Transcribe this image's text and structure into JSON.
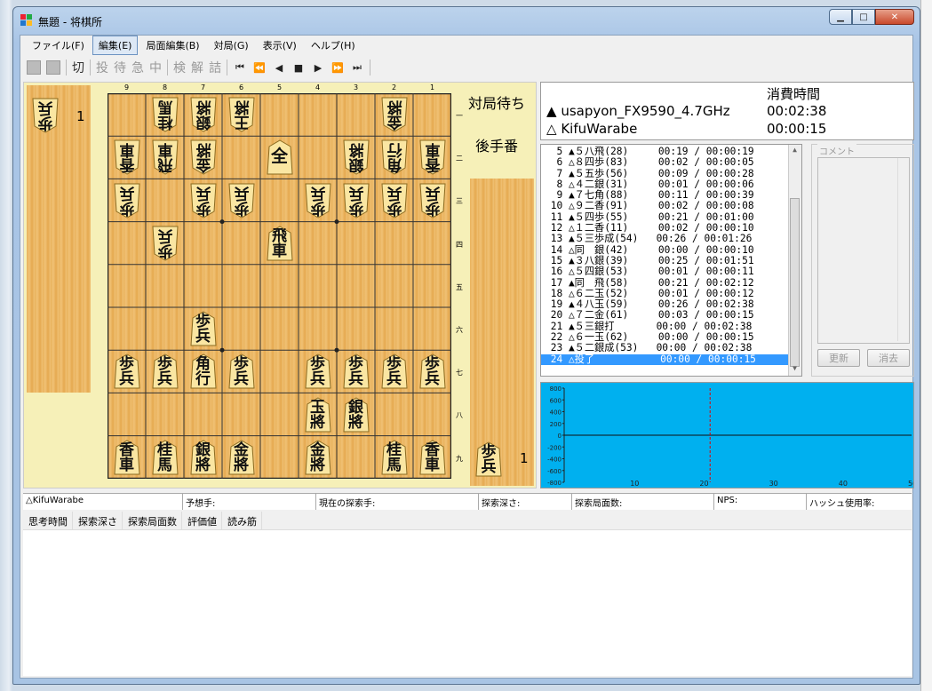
{
  "window": {
    "title": "無題 - 将棋所"
  },
  "menu": [
    "ファイル(F)",
    "編集(E)",
    "局面編集(B)",
    "対局(G)",
    "表示(V)",
    "ヘルプ(H)"
  ],
  "toolbar": {
    "cut": "切",
    "toolchars": [
      "投",
      "待",
      "急",
      "中",
      "検",
      "解",
      "詰"
    ]
  },
  "board": {
    "files": [
      "9",
      "8",
      "7",
      "6",
      "5",
      "4",
      "3",
      "2",
      "1"
    ],
    "ranks": [
      "一",
      "二",
      "三",
      "四",
      "五",
      "六",
      "七",
      "八",
      "九"
    ],
    "pieces": [
      {
        "f": 8,
        "r": 1,
        "t": "桂馬",
        "s": "g"
      },
      {
        "f": 7,
        "r": 1,
        "t": "銀將",
        "s": "g"
      },
      {
        "f": 6,
        "r": 1,
        "t": "王將",
        "s": "g"
      },
      {
        "f": 2,
        "r": 1,
        "t": "金將",
        "s": "g"
      },
      {
        "f": 9,
        "r": 2,
        "t": "香車",
        "s": "g"
      },
      {
        "f": 8,
        "r": 2,
        "t": "飛車",
        "s": "g"
      },
      {
        "f": 7,
        "r": 2,
        "t": "金將",
        "s": "g"
      },
      {
        "f": 5,
        "r": 2,
        "t": "全",
        "s": "s"
      },
      {
        "f": 3,
        "r": 2,
        "t": "銀將",
        "s": "g"
      },
      {
        "f": 2,
        "r": 2,
        "t": "角行",
        "s": "g"
      },
      {
        "f": 1,
        "r": 2,
        "t": "香車",
        "s": "g"
      },
      {
        "f": 9,
        "r": 3,
        "t": "歩兵",
        "s": "g"
      },
      {
        "f": 7,
        "r": 3,
        "t": "歩兵",
        "s": "g"
      },
      {
        "f": 6,
        "r": 3,
        "t": "歩兵",
        "s": "g"
      },
      {
        "f": 4,
        "r": 3,
        "t": "歩兵",
        "s": "g"
      },
      {
        "f": 3,
        "r": 3,
        "t": "歩兵",
        "s": "g"
      },
      {
        "f": 2,
        "r": 3,
        "t": "歩兵",
        "s": "g"
      },
      {
        "f": 1,
        "r": 3,
        "t": "歩兵",
        "s": "g"
      },
      {
        "f": 8,
        "r": 4,
        "t": "歩兵",
        "s": "g"
      },
      {
        "f": 5,
        "r": 4,
        "t": "飛車",
        "s": "s"
      },
      {
        "f": 7,
        "r": 6,
        "t": "歩兵",
        "s": "s"
      },
      {
        "f": 9,
        "r": 7,
        "t": "歩兵",
        "s": "s"
      },
      {
        "f": 8,
        "r": 7,
        "t": "歩兵",
        "s": "s"
      },
      {
        "f": 7,
        "r": 7,
        "t": "角行",
        "s": "s"
      },
      {
        "f": 6,
        "r": 7,
        "t": "歩兵",
        "s": "s"
      },
      {
        "f": 4,
        "r": 7,
        "t": "歩兵",
        "s": "s"
      },
      {
        "f": 3,
        "r": 7,
        "t": "歩兵",
        "s": "s"
      },
      {
        "f": 2,
        "r": 7,
        "t": "歩兵",
        "s": "s"
      },
      {
        "f": 1,
        "r": 7,
        "t": "歩兵",
        "s": "s"
      },
      {
        "f": 4,
        "r": 8,
        "t": "玉將",
        "s": "s"
      },
      {
        "f": 3,
        "r": 8,
        "t": "銀將",
        "s": "s"
      },
      {
        "f": 9,
        "r": 9,
        "t": "香車",
        "s": "s"
      },
      {
        "f": 8,
        "r": 9,
        "t": "桂馬",
        "s": "s"
      },
      {
        "f": 7,
        "r": 9,
        "t": "銀將",
        "s": "s"
      },
      {
        "f": 6,
        "r": 9,
        "t": "金將",
        "s": "s"
      },
      {
        "f": 4,
        "r": 9,
        "t": "金將",
        "s": "s"
      },
      {
        "f": 2,
        "r": 9,
        "t": "桂馬",
        "s": "s"
      },
      {
        "f": 1,
        "r": 9,
        "t": "香車",
        "s": "s"
      }
    ]
  },
  "hands": {
    "gote": {
      "piece": "歩兵",
      "count": "1"
    },
    "sente": {
      "piece": "歩兵",
      "count": "1"
    }
  },
  "status": {
    "state": "対局待ち",
    "turn": "後手番"
  },
  "clock": {
    "header": "消費時間",
    "sente": {
      "mark": "▲",
      "name": "usapyon_FX9590_4.7GHz",
      "time": "00:02:38"
    },
    "gote": {
      "mark": "△",
      "name": "KifuWarabe",
      "time": "00:00:15"
    }
  },
  "kifu": [
    "  5 ▲５八飛(28)     00:19 / 00:00:19",
    "  6 △８四歩(83)     00:02 / 00:00:05",
    "  7 ▲５五歩(56)     00:09 / 00:00:28",
    "  8 △４二銀(31)     00:01 / 00:00:06",
    "  9 ▲７七角(88)     00:11 / 00:00:39",
    " 10 △９二香(91)     00:02 / 00:00:08",
    " 11 ▲５四歩(55)     00:21 / 00:01:00",
    " 12 △１二香(11)     00:02 / 00:00:10",
    " 13 ▲５三歩成(54)   00:26 / 00:01:26",
    " 14 △同　銀(42)     00:00 / 00:00:10",
    " 15 ▲３八銀(39)     00:25 / 00:01:51",
    " 16 △５四銀(53)     00:01 / 00:00:11",
    " 17 ▲同　飛(58)     00:21 / 00:02:12",
    " 18 △６二玉(52)     00:01 / 00:00:12",
    " 19 ▲４八玉(59)     00:26 / 00:02:38",
    " 20 △７二金(61)     00:03 / 00:00:15",
    " 21 ▲５三銀打       00:00 / 00:02:38",
    " 22 △６一玉(62)     00:00 / 00:00:15",
    " 23 ▲５二銀成(53)   00:00 / 00:02:38",
    " 24 △投了           00:00 / 00:00:15"
  ],
  "comment": {
    "label": "コメント",
    "update": "更新",
    "clear": "消去"
  },
  "graph": {
    "yticks": [
      "800",
      "600",
      "400",
      "200",
      "0",
      "-200",
      "-400",
      "-600",
      "-800"
    ],
    "xticks": [
      "10",
      "20",
      "30",
      "40",
      "50"
    ],
    "bg": "#00b0ef"
  },
  "info": {
    "engine": "△KifuWarabe",
    "predict": "予想手:",
    "current": "現在の探索手:",
    "depth": "探索深さ:",
    "nodes": "探索局面数:",
    "nps": "NPS:",
    "hash": "ハッシュ使用率:"
  },
  "columns": [
    "思考時間",
    "探索深さ",
    "探索局面数",
    "評価値",
    "読み筋"
  ]
}
